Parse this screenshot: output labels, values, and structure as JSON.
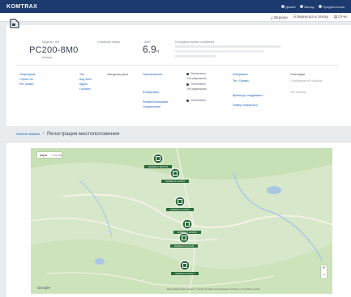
{
  "header": {
    "logo": "KOMTRAX",
    "nav": [
      {
        "label": "Домой",
        "icon": "home-icon"
      },
      {
        "label": "Выход",
        "icon": "logout-icon"
      },
      {
        "label": "Предпочтения",
        "icon": "settings-icon"
      }
    ]
  },
  "subbar": {
    "items": [
      {
        "label": "Загрузка",
        "icon": "download-icon"
      },
      {
        "label": "Вернуться к списку",
        "icon": "list-icon"
      },
      {
        "label": "Отчет",
        "icon": "report-icon"
      }
    ]
  },
  "machine": {
    "icon": "excavator-icon",
    "model_label": "Модель / тип",
    "model": "PC200-8M0",
    "type_line": "Комацу",
    "sn_label": "Серийный номер",
    "smr_label": "SMR",
    "hours": "6.9",
    "hours_unit": "ч",
    "last_report_label": "Последнее время сообщения"
  },
  "details": {
    "col1": [
      "Нефтьпром",
      "Строит-ль",
      "Рег. номер"
    ],
    "col2": [
      "Тип",
      "Код Zone",
      "Адрес",
      "Location"
    ],
    "col3": [
      "Заводская дата"
    ],
    "col4": [
      "Перемещения",
      "Блокировка",
      "Режим блокировки",
      "Ограничение"
    ],
    "radio_options": [
      "Отключено",
      "Не разрешено",
      "Отключено",
      "Не разрешено",
      "Отключено"
    ],
    "col6": [
      "Интервалы",
      "Тех. Сервис",
      "Время до следующего",
      "Номер сервисного"
    ],
    "col7": [
      "Неполадки",
      "Сообщения об ошибках",
      "Нет ошибок"
    ]
  },
  "breadcrumb": {
    "parent": "Список машин",
    "separator": ">",
    "title": "Регистрация местоположения"
  },
  "map": {
    "toggle": [
      "Карта",
      "Спутник"
    ],
    "zoom_in": "+",
    "zoom_out": "−",
    "footer": "Картографические данные © Google   Условия использования   Сообщить об ошибке на карте",
    "brand": "Google",
    "markers": [
      {
        "label": "2023/01/17 20:57:26"
      },
      {
        "label": "2023/01/17 21:03:10"
      },
      {
        "label": "2023/01/17 21:35:41"
      },
      {
        "label": "2023/01/17 22:02:18"
      },
      {
        "label": "2023/01/17 22:41:05"
      },
      {
        "label": "2023/01/17 23:20:47"
      }
    ]
  }
}
